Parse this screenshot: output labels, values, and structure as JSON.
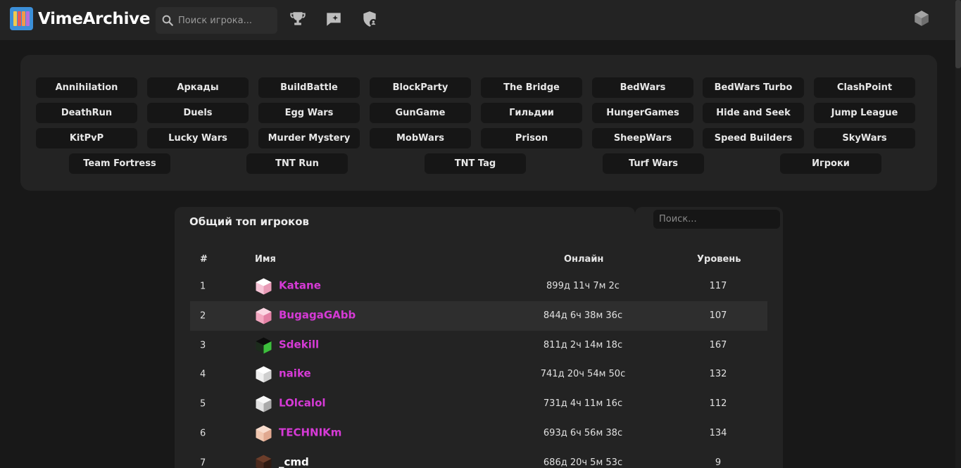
{
  "header": {
    "logo_text": "VimeArchive",
    "search_placeholder": "Поиск игрока...",
    "icons": [
      "trophy-icon",
      "chat-plus-icon",
      "shield-user-icon",
      "cube-icon"
    ]
  },
  "modes": [
    "Annihilation",
    "Аркады",
    "BuildBattle",
    "BlockParty",
    "The Bridge",
    "BedWars",
    "BedWars Turbo",
    "ClashPoint",
    "DeathRun",
    "Duels",
    "Egg Wars",
    "GunGame",
    "Гильдии",
    "HungerGames",
    "Hide and Seek",
    "Jump League",
    "KitPvP",
    "Lucky Wars",
    "Murder Mystery",
    "MobWars",
    "Prison",
    "SheepWars",
    "Speed Builders",
    "SkyWars",
    "Team Fortress",
    "TNT Run",
    "TNT Tag",
    "Turf Wars",
    "Игроки"
  ],
  "table": {
    "title": "Общий топ игроков",
    "search_placeholder": "Поиск...",
    "headers": {
      "rank": "#",
      "name": "Имя",
      "online": "Онлайн",
      "level": "Уровень"
    },
    "rows": [
      {
        "rank": "1",
        "name": "Katane",
        "online": "899д 11ч 7м 2с",
        "level": "117",
        "name_color": "#d63ad6",
        "avatar": "pink"
      },
      {
        "rank": "2",
        "name": "BugagaGAbb",
        "online": "844д 6ч 38м 36с",
        "level": "107",
        "name_color": "#d63ad6",
        "avatar": "pink2"
      },
      {
        "rank": "3",
        "name": "Sdekill",
        "online": "811д 2ч 14м 18с",
        "level": "167",
        "name_color": "#d63ad6",
        "avatar": "dark"
      },
      {
        "rank": "4",
        "name": "naike",
        "online": "741д 20ч 54м 50с",
        "level": "132",
        "name_color": "#d63ad6",
        "avatar": "white"
      },
      {
        "rank": "5",
        "name": "LOlcalol",
        "online": "731д 4ч 11м 16с",
        "level": "112",
        "name_color": "#d63ad6",
        "avatar": "gray"
      },
      {
        "rank": "6",
        "name": "TECHNIKm",
        "online": "693д 6ч 56м 38с",
        "level": "134",
        "name_color": "#d63ad6",
        "avatar": "skin"
      },
      {
        "rank": "7",
        "name": "_cmd",
        "online": "686д 20ч 5м 53с",
        "level": "9",
        "name_color": "#ffffff",
        "avatar": "brown"
      }
    ]
  },
  "colors": {
    "background": "#181818",
    "panel": "#232323",
    "button": "#161616",
    "player_name": "#d63ad6"
  }
}
